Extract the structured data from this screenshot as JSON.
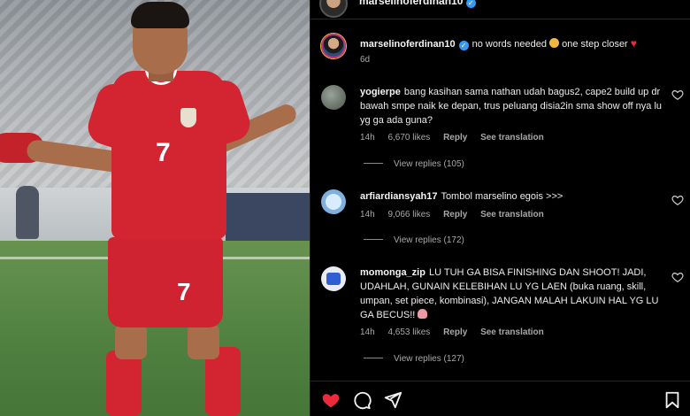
{
  "post": {
    "username": "marselinoferdinan10",
    "caption": "no words needed",
    "caption_tail": "one step closer",
    "age": "6d"
  },
  "comments": [
    {
      "username": "yogierpe",
      "text": "bang kasihan sama nathan udah bagus2, cape2 build up dr bawah smpe naik ke depan, trus peluang disia2in sma show off nya lu yg ga ada guna?",
      "time": "14h",
      "likes": "6,670 likes",
      "reply_label": "Reply",
      "translate_label": "See translation",
      "view_replies": "View replies (105)"
    },
    {
      "username": "arfiardiansyah17",
      "text": "Tombol marselino egois >>>",
      "time": "14h",
      "likes": "9,066 likes",
      "reply_label": "Reply",
      "translate_label": "See translation",
      "view_replies": "View replies (172)"
    },
    {
      "username": "momonga_zip",
      "text": "LU TUH GA BISA FINISHING DAN SHOOT! JADI, UDAHLAH, GUNAIN KELEBIHAN LU YG LAEN (buka ruang, skill, umpan, set piece, kombinasi), JANGAN MALAH LAKUIN HAL YG LU GA BECUS!!",
      "time": "14h",
      "likes": "4,653 likes",
      "reply_label": "Reply",
      "translate_label": "See translation",
      "view_replies": "View replies (127)"
    }
  ],
  "photo": {
    "shirt_number": "7",
    "shorts_number": "7"
  },
  "colors": {
    "like_red": "#ed2a3c",
    "verified_blue": "#3897f0",
    "jersey_red": "#d22431"
  },
  "icons": [
    "heart-filled-icon",
    "comment-icon",
    "share-icon",
    "bookmark-icon",
    "heart-outline-icon",
    "verified-icon"
  ]
}
